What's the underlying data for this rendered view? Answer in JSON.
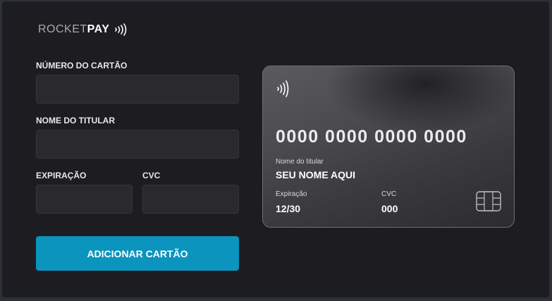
{
  "logo": {
    "rocket": "ROCKET",
    "pay": "PAY",
    "icon": "contactless-icon"
  },
  "form": {
    "card_number": {
      "label": "NÚMERO DO CARTÃO",
      "value": ""
    },
    "holder_name": {
      "label": "NOME DO TITULAR",
      "value": ""
    },
    "expiration": {
      "label": "EXPIRAÇÃO",
      "value": ""
    },
    "cvc": {
      "label": "CVC",
      "value": ""
    },
    "submit_label": "ADICIONAR CARTÃO"
  },
  "card": {
    "number": "0000 0000 0000 0000",
    "holder_label": "Nome do titular",
    "holder_value": "SEU NOME AQUI",
    "expiration_label": "Expiração",
    "expiration_value": "12/30",
    "cvc_label": "CVC",
    "cvc_value": "000",
    "chip_icon": "chip-icon",
    "contactless_icon": "contactless-icon"
  },
  "colors": {
    "background": "#2b3039",
    "panel": "#1d1d21",
    "input": "#29292e",
    "accent": "#0b94bd"
  }
}
